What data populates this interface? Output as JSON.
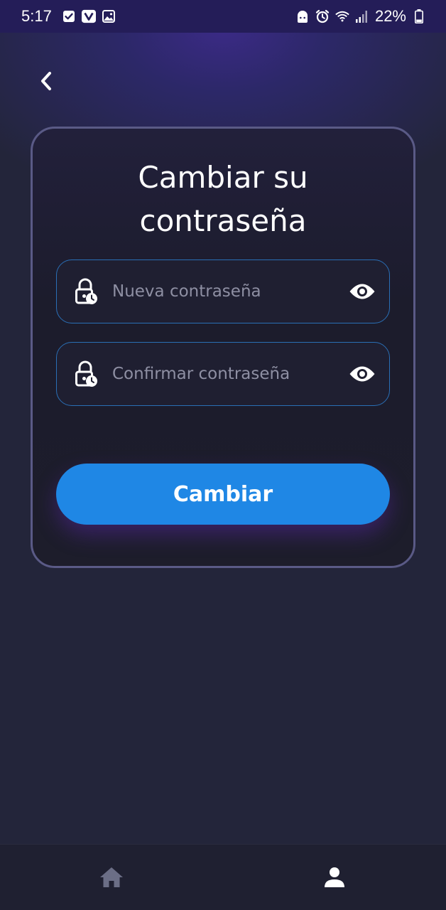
{
  "status_bar": {
    "time": "5:17",
    "battery": "22%",
    "left_icons": [
      "check-box-icon",
      "v-app-icon",
      "image-icon"
    ],
    "right_icons": [
      "android-icon",
      "alarm-icon",
      "wifi-icon",
      "signal-icon",
      "battery-icon"
    ]
  },
  "header": {
    "back_icon": "chevron-left-icon"
  },
  "form": {
    "title": "Cambiar su contraseña",
    "new_password": {
      "placeholder": "Nueva contraseña",
      "value": "",
      "icon": "lock-clock-icon",
      "toggle_icon": "eye-icon"
    },
    "confirm_password": {
      "placeholder": "Confirmar contraseña",
      "value": "",
      "icon": "lock-clock-icon",
      "toggle_icon": "eye-icon"
    },
    "submit_label": "Cambiar"
  },
  "bottom_nav": {
    "items": [
      {
        "icon": "home-icon",
        "active": false
      },
      {
        "icon": "person-icon",
        "active": true
      }
    ]
  },
  "colors": {
    "background": "#23253a",
    "card": "#1d1d2b",
    "card_border": "#5a5a86",
    "field_border": "#2a6fb6",
    "accent": "#1f87e5",
    "placeholder": "#8e8fa3",
    "nav_inactive": "#6b6e86",
    "nav_active": "#ffffff"
  }
}
